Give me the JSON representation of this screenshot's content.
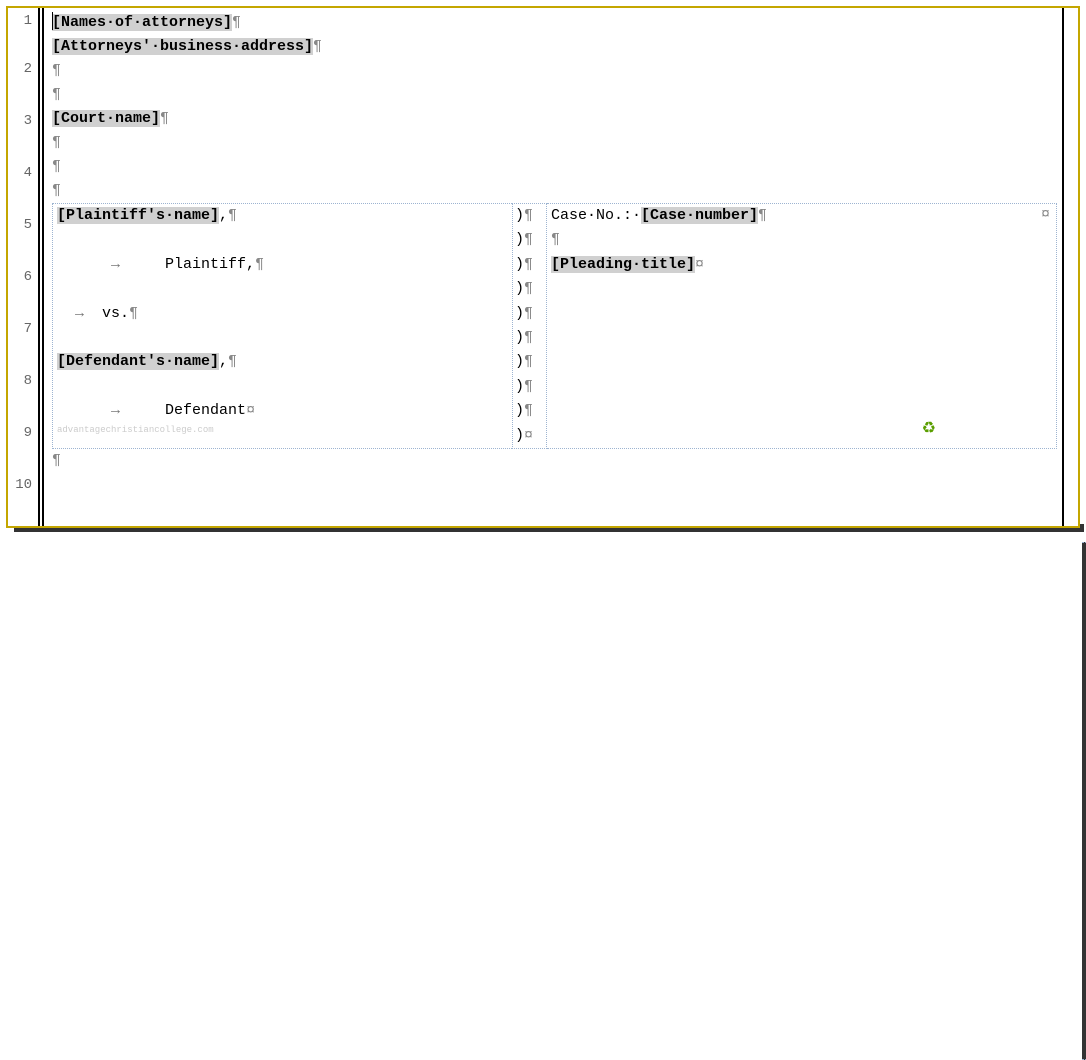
{
  "lineNumbers": [
    "1",
    "2",
    "3",
    "4",
    "5",
    "6",
    "7",
    "8",
    "9",
    "10"
  ],
  "marks": {
    "pilcrow": "¶",
    "tab": "→",
    "dot": "·",
    "cellEnd": "¤",
    "paren": ")"
  },
  "fields": {
    "attorneys": "[Names·of·attorneys]",
    "address": "[Attorneys'·business·address]",
    "court": "[Court·name]",
    "plaintiffName": "[Plaintiff's·name]",
    "defendantName": "[Defendant's·name]",
    "caseNumber": "[Case·number]",
    "pleadingTitle": "[Pleading·title]"
  },
  "static": {
    "plaintiffComma": ",",
    "plaintiffLabel": "Plaintiff,",
    "vs": "vs.",
    "defendantComma": ",",
    "defendantLabel": "Defendant",
    "caseNoPrefix": "Case·No.:·"
  },
  "watermark": "advantagechristiancollege.com"
}
